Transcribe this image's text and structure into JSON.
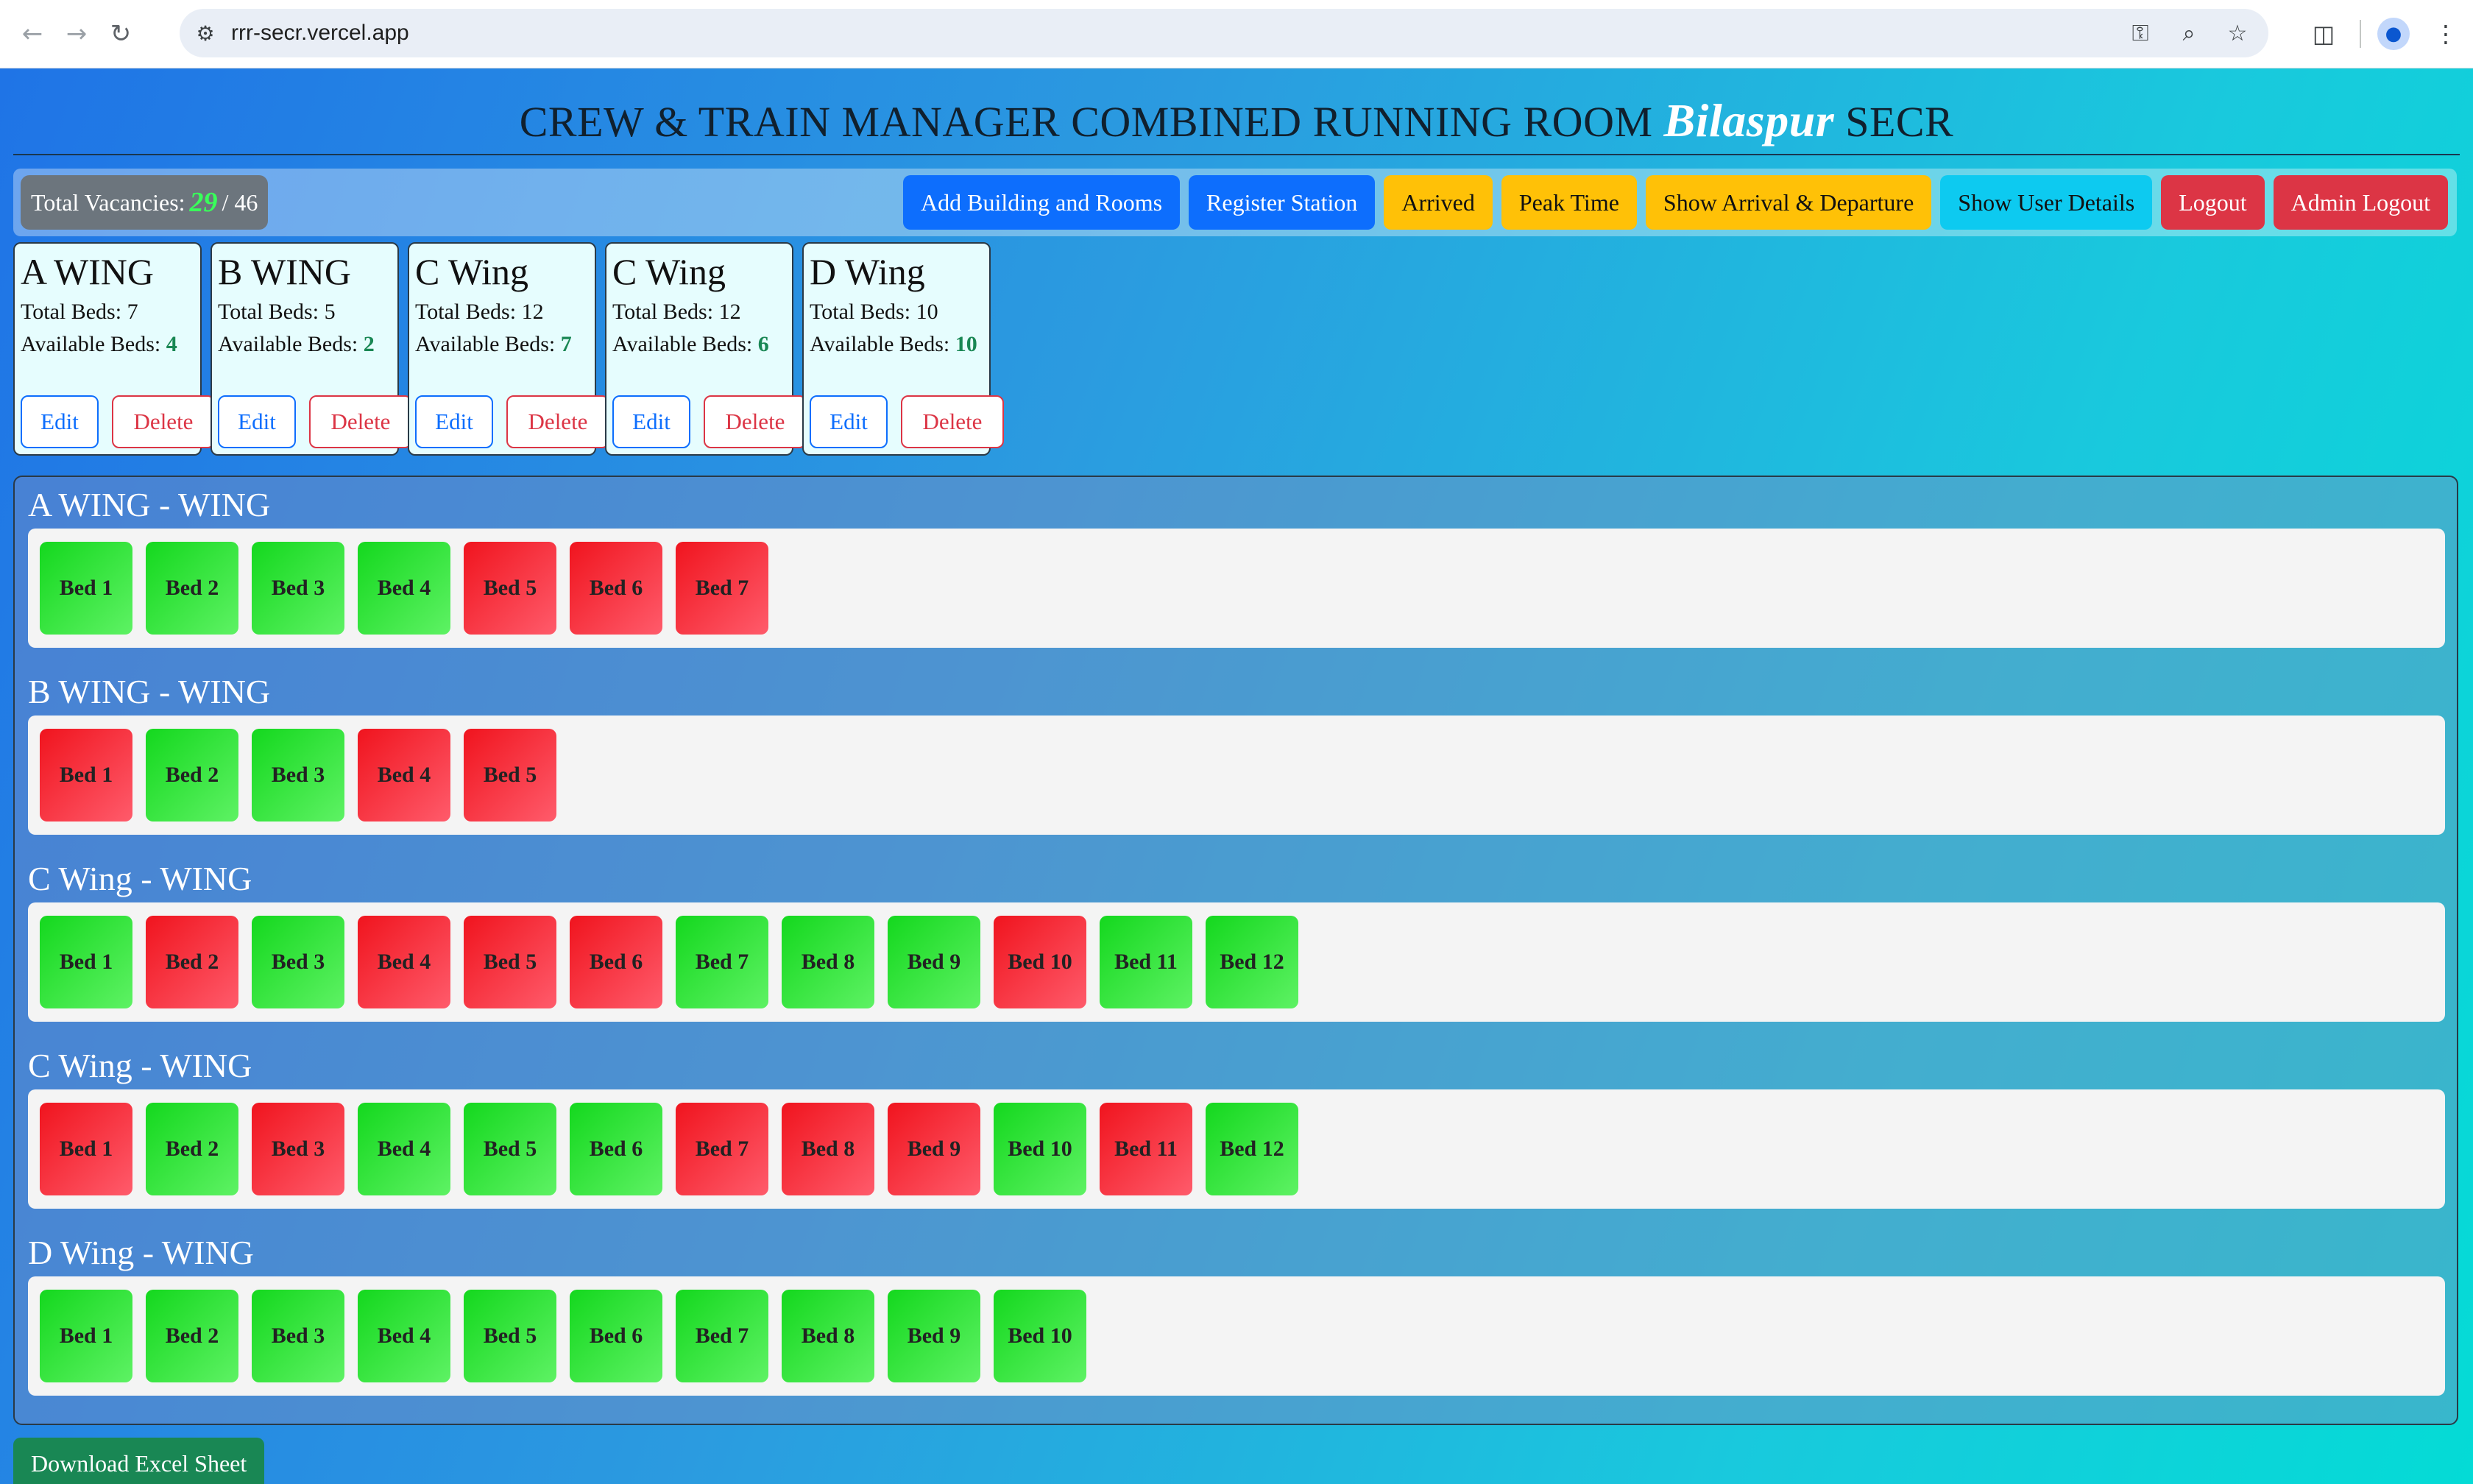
{
  "browser": {
    "url": "rrr-secr.vercel.app"
  },
  "header": {
    "title_prefix": "CREW & TRAIN MANAGER COMBINED RUNNING ROOM",
    "city": "Bilaspur",
    "title_suffix": "SECR"
  },
  "vacancy": {
    "label": "Total Vacancies:",
    "available": "29",
    "total": "/ 46"
  },
  "toolbar": {
    "buttons": [
      {
        "label": "Add Building and Rooms",
        "style": "blue"
      },
      {
        "label": "Register Station",
        "style": "blue"
      },
      {
        "label": "Arrived",
        "style": "yellow"
      },
      {
        "label": "Peak Time",
        "style": "yellow"
      },
      {
        "label": "Show Arrival & Departure",
        "style": "yellow"
      },
      {
        "label": "Show User Details",
        "style": "cyan"
      },
      {
        "label": "Logout",
        "style": "red"
      },
      {
        "label": "Admin Logout",
        "style": "red"
      }
    ]
  },
  "labels": {
    "total_beds": "Total Beds:",
    "available_beds": "Available Beds:",
    "edit": "Edit",
    "delete": "Delete",
    "download": "Download Excel Sheet"
  },
  "wings": [
    {
      "name": "A WING",
      "total": "7",
      "available": "4",
      "section_title": "A WING - WING",
      "beds": [
        {
          "label": "Bed 1",
          "status": "available"
        },
        {
          "label": "Bed 2",
          "status": "available"
        },
        {
          "label": "Bed 3",
          "status": "available"
        },
        {
          "label": "Bed 4",
          "status": "available"
        },
        {
          "label": "Bed 5",
          "status": "occupied"
        },
        {
          "label": "Bed 6",
          "status": "occupied"
        },
        {
          "label": "Bed 7",
          "status": "occupied"
        }
      ]
    },
    {
      "name": "B WING",
      "total": "5",
      "available": "2",
      "section_title": "B WING - WING",
      "beds": [
        {
          "label": "Bed 1",
          "status": "occupied"
        },
        {
          "label": "Bed 2",
          "status": "available"
        },
        {
          "label": "Bed 3",
          "status": "available"
        },
        {
          "label": "Bed 4",
          "status": "occupied"
        },
        {
          "label": "Bed 5",
          "status": "occupied"
        }
      ]
    },
    {
      "name": "C Wing",
      "total": "12",
      "available": "7",
      "section_title": "C Wing - WING",
      "beds": [
        {
          "label": "Bed 1",
          "status": "available"
        },
        {
          "label": "Bed 2",
          "status": "occupied"
        },
        {
          "label": "Bed 3",
          "status": "available"
        },
        {
          "label": "Bed 4",
          "status": "occupied"
        },
        {
          "label": "Bed 5",
          "status": "occupied"
        },
        {
          "label": "Bed 6",
          "status": "occupied"
        },
        {
          "label": "Bed 7",
          "status": "available"
        },
        {
          "label": "Bed 8",
          "status": "available"
        },
        {
          "label": "Bed 9",
          "status": "available"
        },
        {
          "label": "Bed 10",
          "status": "occupied"
        },
        {
          "label": "Bed 11",
          "status": "available"
        },
        {
          "label": "Bed 12",
          "status": "available"
        }
      ]
    },
    {
      "name": "C Wing",
      "total": "12",
      "available": "6",
      "section_title": "C Wing - WING",
      "beds": [
        {
          "label": "Bed 1",
          "status": "occupied"
        },
        {
          "label": "Bed 2",
          "status": "available"
        },
        {
          "label": "Bed 3",
          "status": "occupied"
        },
        {
          "label": "Bed 4",
          "status": "available"
        },
        {
          "label": "Bed 5",
          "status": "available"
        },
        {
          "label": "Bed 6",
          "status": "available"
        },
        {
          "label": "Bed 7",
          "status": "occupied"
        },
        {
          "label": "Bed 8",
          "status": "occupied"
        },
        {
          "label": "Bed 9",
          "status": "occupied"
        },
        {
          "label": "Bed 10",
          "status": "available"
        },
        {
          "label": "Bed 11",
          "status": "occupied"
        },
        {
          "label": "Bed 12",
          "status": "available"
        }
      ]
    },
    {
      "name": "D Wing",
      "total": "10",
      "available": "10",
      "section_title": "D Wing - WING",
      "beds": [
        {
          "label": "Bed 1",
          "status": "available"
        },
        {
          "label": "Bed 2",
          "status": "available"
        },
        {
          "label": "Bed 3",
          "status": "available"
        },
        {
          "label": "Bed 4",
          "status": "available"
        },
        {
          "label": "Bed 5",
          "status": "available"
        },
        {
          "label": "Bed 6",
          "status": "available"
        },
        {
          "label": "Bed 7",
          "status": "available"
        },
        {
          "label": "Bed 8",
          "status": "available"
        },
        {
          "label": "Bed 9",
          "status": "available"
        },
        {
          "label": "Bed 10",
          "status": "available"
        }
      ]
    }
  ],
  "colors": {
    "available": "#14d81e",
    "occupied": "#f0141e",
    "vacancy_number": "#39ff5a"
  }
}
